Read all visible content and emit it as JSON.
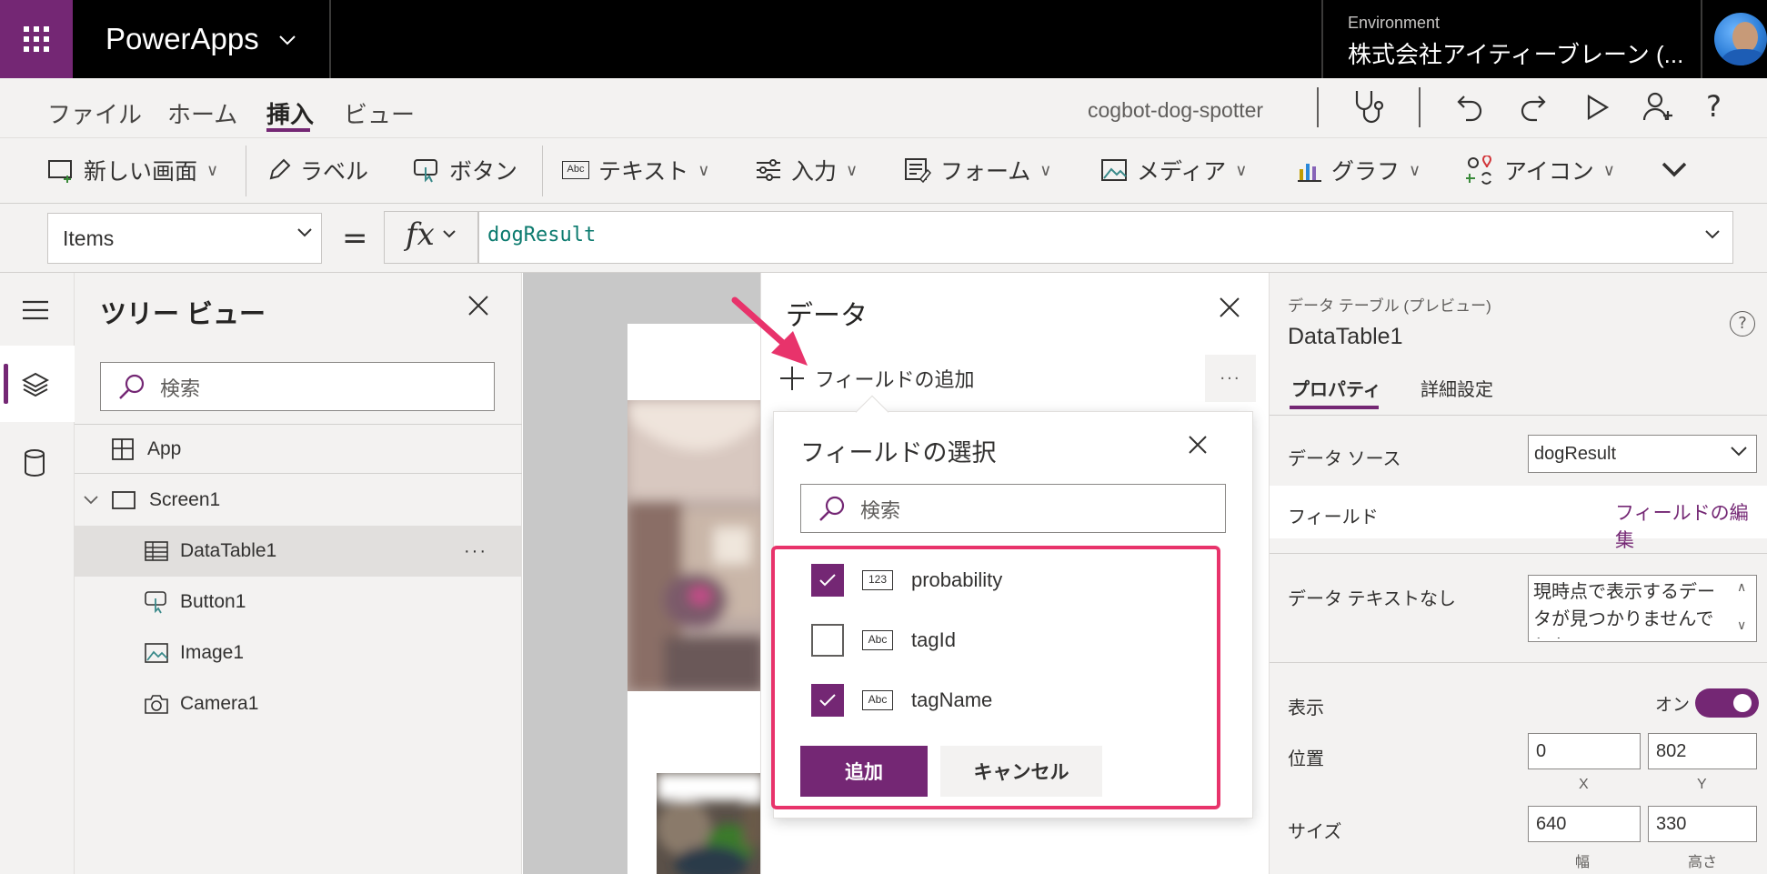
{
  "topbar": {
    "app_name": "PowerApps",
    "environment_label": "Environment",
    "environment_name": "株式会社アイティーブレーン (..."
  },
  "menu": {
    "items": [
      "ファイル",
      "ホーム",
      "挿入",
      "ビュー"
    ],
    "active": "挿入",
    "project_name": "cogbot-dog-spotter"
  },
  "ribbon": {
    "new_screen": "新しい画面",
    "label": "ラベル",
    "button": "ボタン",
    "text": "テキスト",
    "input": "入力",
    "form": "フォーム",
    "media": "メディア",
    "chart": "グラフ",
    "icons": "アイコン"
  },
  "formula": {
    "property": "Items",
    "equals": "=",
    "fx": "fx",
    "value": "dogResult"
  },
  "tree": {
    "title": "ツリー ビュー",
    "search_placeholder": "検索",
    "items": [
      {
        "label": "App"
      },
      {
        "label": "Screen1"
      },
      {
        "label": "DataTable1",
        "more": "···"
      },
      {
        "label": "Button1"
      },
      {
        "label": "Image1"
      },
      {
        "label": "Camera1"
      }
    ]
  },
  "data_panel": {
    "title": "データ",
    "add_field": "フィールドの追加",
    "more": "···"
  },
  "field_picker": {
    "title": "フィールドの選択",
    "search_placeholder": "検索",
    "fields": [
      {
        "name": "probability",
        "type_icon": "123",
        "checked": true
      },
      {
        "name": "tagId",
        "type_icon": "Abc",
        "checked": false
      },
      {
        "name": "tagName",
        "type_icon": "Abc",
        "checked": true
      }
    ],
    "add_button": "追加",
    "cancel_button": "キャンセル"
  },
  "properties": {
    "control_type": "データ テーブル (プレビュー)",
    "control_name": "DataTable1",
    "help": "?",
    "tabs": [
      "プロパティ",
      "詳細設定"
    ],
    "datasource_label": "データ ソース",
    "datasource_value": "dogResult",
    "fields_label": "フィールド",
    "edit_fields": "フィールドの編集",
    "nodata_label": "データ テキストなし",
    "nodata_value": "現時点で表示するデータが見つかりませんでした。",
    "visible_label": "表示",
    "visible_value": "オン",
    "position_label": "位置",
    "position_x": "0",
    "position_y": "802",
    "x_label": "X",
    "y_label": "Y",
    "size_label": "サイズ",
    "width": "640",
    "height": "330",
    "width_label": "幅",
    "height_label": "高さ"
  },
  "colors": {
    "brand": "#742774",
    "highlight": "#e8336b",
    "formula_text": "#0b7a6e"
  }
}
